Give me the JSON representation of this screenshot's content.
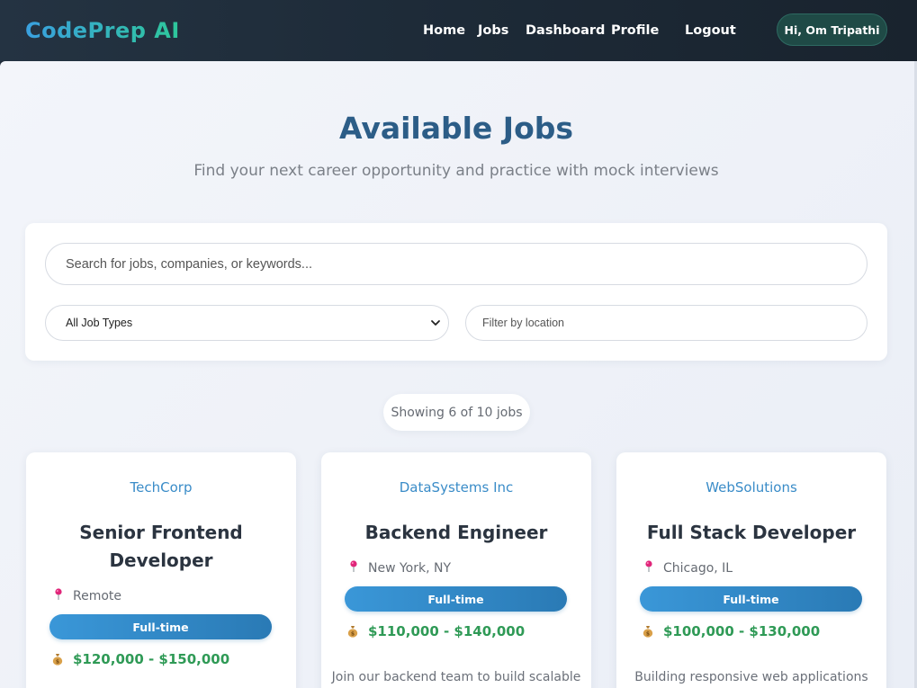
{
  "app": {
    "logo": "CodePrep AI"
  },
  "nav": {
    "links": [
      "Home",
      "Jobs",
      "Dashboard",
      "Profile",
      "Logout"
    ],
    "greeting": "Hi, Om Tripathi"
  },
  "header": {
    "title": "Available Jobs",
    "subtitle": "Find your next career opportunity and practice with mock interviews"
  },
  "search": {
    "placeholder": "Search for jobs, companies, or keywords...",
    "job_type_selected": "All Job Types",
    "location_placeholder": "Filter by location"
  },
  "results": {
    "count_text": "Showing 6 of 10 jobs"
  },
  "jobs": [
    {
      "company": "TechCorp",
      "title_line1": "Senior Frontend",
      "title_line2": "Developer",
      "location": "Remote",
      "type": "Full-time",
      "salary": "$120,000 - $150,000",
      "description": ""
    },
    {
      "company": "DataSystems Inc",
      "title_line1": "Backend Engineer",
      "title_line2": "",
      "location": "New York, NY",
      "type": "Full-time",
      "salary": "$110,000 - $140,000",
      "description": "Join our backend team to build scalable"
    },
    {
      "company": "WebSolutions",
      "title_line1": "Full Stack Developer",
      "title_line2": "",
      "location": "Chicago, IL",
      "type": "Full-time",
      "salary": "$100,000 - $130,000",
      "description": "Building responsive web applications"
    }
  ],
  "icons": {
    "location": "pushpin-icon",
    "salary": "money-bag-icon"
  },
  "colors": {
    "accent": "#2c5d87",
    "company": "#3a8cc8",
    "salary": "#2f9a56",
    "pill": "#3a97d8"
  }
}
